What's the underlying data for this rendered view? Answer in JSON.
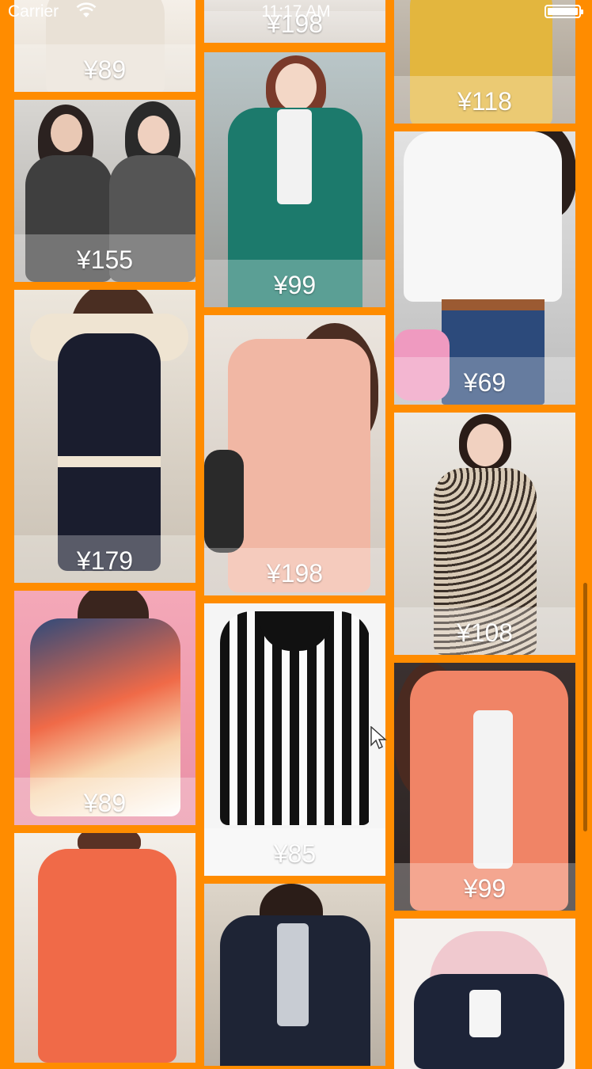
{
  "status_bar": {
    "carrier": "Carrier",
    "time": "11:17 AM",
    "wifi_icon": "wifi-icon",
    "battery_icon": "battery-icon"
  },
  "colors": {
    "background": "#ff8c00",
    "price_text": "#ffffff"
  },
  "columns": [
    {
      "items": [
        {
          "price": "¥89",
          "description": "cream knit top (partially scrolled)",
          "bg": "#eee6dc",
          "garment": "#e9e1d6"
        },
        {
          "price": "¥155",
          "description": "two women in grey knit hoodies",
          "bg": "#c9c9c9",
          "garment": "#3f3f3f"
        },
        {
          "price": "¥179",
          "description": "navy and cream knit dress",
          "bg": "#d9d2c6",
          "garment": "#1a1d2e"
        },
        {
          "price": "¥89",
          "description": "navy-to-peach gradient cable sweater",
          "bg": "#f2a2b4",
          "garment": "#f3b48e"
        },
        {
          "price": "",
          "description": "coral sweater",
          "bg": "#efe8e0",
          "garment": "#f06a48"
        }
      ]
    },
    {
      "items": [
        {
          "price": "¥198",
          "description": "light top (partially scrolled)",
          "bg": "#e7e2de",
          "garment": "#d6cfc8"
        },
        {
          "price": "¥99",
          "description": "teal wool coat",
          "bg": "#b8b6b2",
          "garment": "#1c7a6c"
        },
        {
          "price": "¥198",
          "description": "pink trench coat",
          "bg": "#e4dcd4",
          "garment": "#f1b7a4"
        },
        {
          "price": "¥85",
          "description": "black and white striped sweater",
          "bg": "#f4f4f4",
          "garment": "#2b2b2b"
        },
        {
          "price": "",
          "description": "navy blazer",
          "bg": "#cfc8bd",
          "garment": "#1e2435"
        }
      ]
    },
    {
      "items": [
        {
          "price": "¥118",
          "description": "mustard yellow jacket",
          "bg": "#bcb3a6",
          "garment": "#e3b63e"
        },
        {
          "price": "¥69",
          "description": "white shirt with jeans",
          "bg": "#d8d8d8",
          "garment": "#f7f7f7"
        },
        {
          "price": "¥108",
          "description": "leopard print dress",
          "bg": "#e6e2dc",
          "garment": "#6e6253"
        },
        {
          "price": "¥99",
          "description": "peach padded jacket",
          "bg": "#3b3130",
          "garment": "#f08466"
        },
        {
          "price": "",
          "description": "navy hooded puffer jacket",
          "bg": "#f4f1ee",
          "garment": "#1d2438"
        }
      ]
    }
  ]
}
